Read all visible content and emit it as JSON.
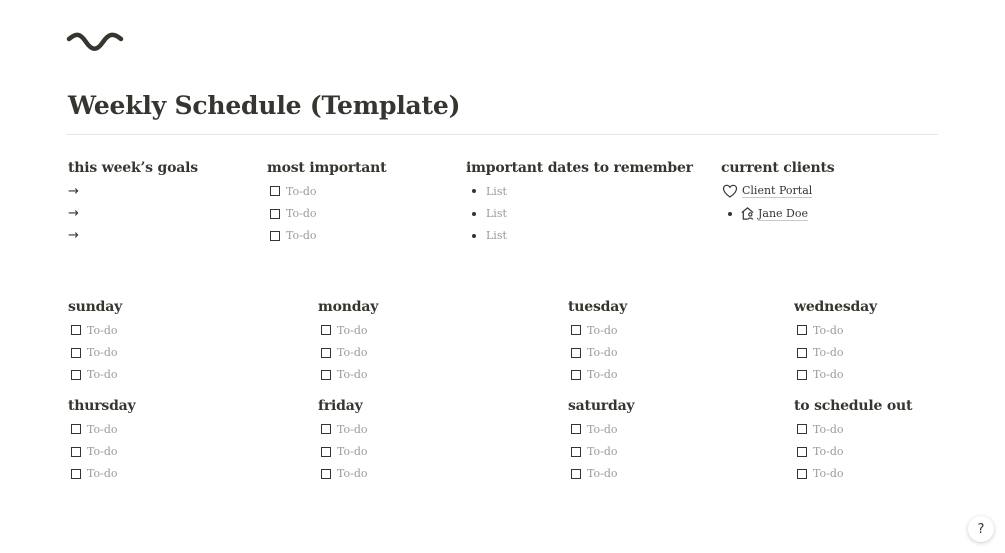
{
  "page": {
    "title": "Weekly Schedule (Template)"
  },
  "top": {
    "goals": {
      "heading": "this  week’s goals",
      "items": [
        "→",
        "→",
        "→"
      ]
    },
    "important": {
      "heading": "most important",
      "items": [
        "To-do",
        "To-do",
        "To-do"
      ]
    },
    "dates": {
      "heading": "important dates to remember",
      "items": [
        "List",
        "List",
        "List"
      ]
    },
    "clients": {
      "heading": "current clients",
      "portal": {
        "icon": "heart-icon",
        "label": "Client Portal"
      },
      "client": {
        "icon": "house-person-icon",
        "label": "Jane Doe"
      }
    }
  },
  "days": {
    "sunday": {
      "heading": "sunday",
      "items": [
        "To-do",
        "To-do",
        "To-do"
      ]
    },
    "monday": {
      "heading": "monday",
      "items": [
        "To-do",
        "To-do",
        "To-do"
      ]
    },
    "tuesday": {
      "heading": "tuesday",
      "items": [
        "To-do",
        "To-do",
        "To-do"
      ]
    },
    "wednesday": {
      "heading": "wednesday",
      "items": [
        "To-do",
        "To-do",
        "To-do"
      ]
    },
    "thursday": {
      "heading": "thursday",
      "items": [
        "To-do",
        "To-do",
        "To-do"
      ]
    },
    "friday": {
      "heading": "friday",
      "items": [
        "To-do",
        "To-do",
        "To-do"
      ]
    },
    "saturday": {
      "heading": "saturday",
      "items": [
        "To-do",
        "To-do",
        "To-do"
      ]
    },
    "later": {
      "heading": "to schedule out",
      "items": [
        "To-do",
        "To-do",
        "To-do"
      ]
    }
  },
  "help": {
    "label": "?"
  }
}
